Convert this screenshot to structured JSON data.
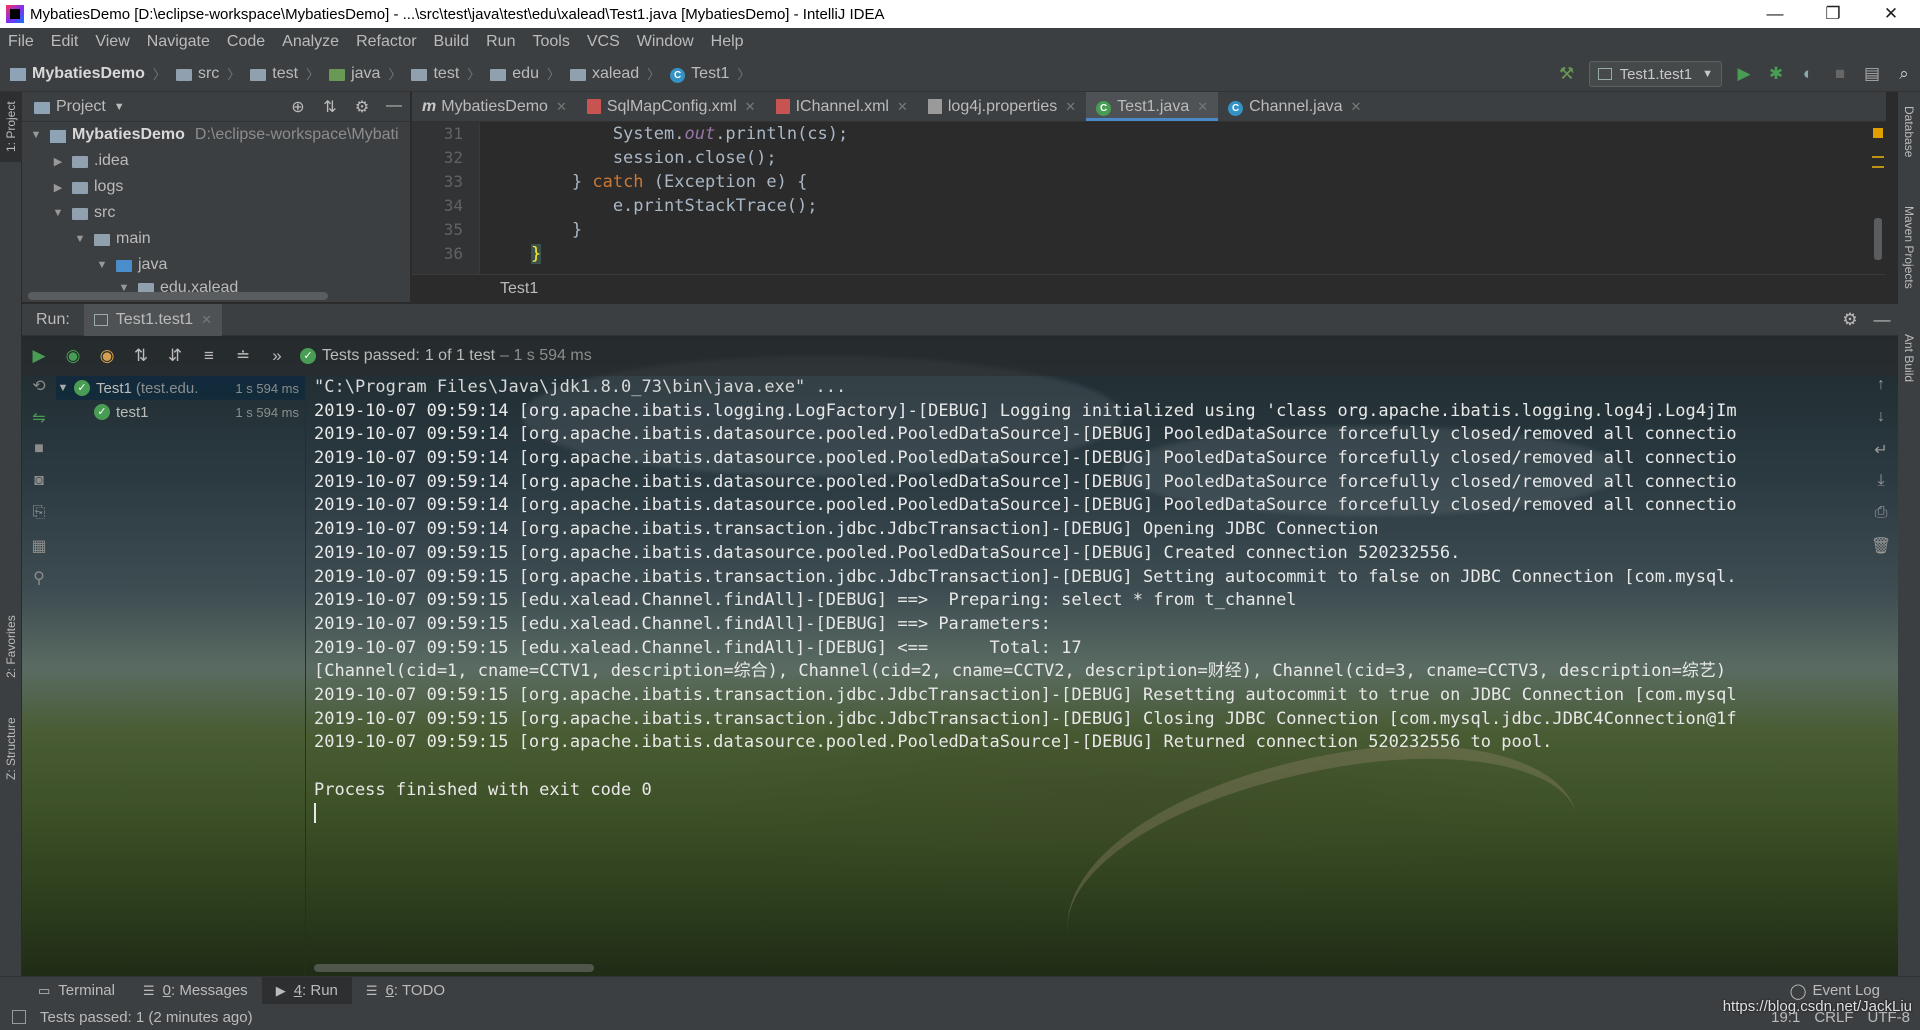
{
  "window": {
    "title": "MybatiesDemo [D:\\eclipse-workspace\\MybatiesDemo] - ...\\src\\test\\java\\test\\edu\\xalead\\Test1.java [MybatiesDemo] - IntelliJ IDEA",
    "minimize": "—",
    "restore": "❐",
    "close": "✕"
  },
  "menu": [
    "File",
    "Edit",
    "View",
    "Navigate",
    "Code",
    "Analyze",
    "Refactor",
    "Build",
    "Run",
    "Tools",
    "VCS",
    "Window",
    "Help"
  ],
  "breadcrumb": [
    "MybatiesDemo",
    "src",
    "test",
    "java",
    "test",
    "edu",
    "xalead",
    "Test1"
  ],
  "toolbar": {
    "run_config": "Test1.test1"
  },
  "project_panel": {
    "title": "Project",
    "root_name": "MybatiesDemo",
    "root_path": "D:\\eclipse-workspace\\Mybati",
    "tree": [
      ".idea",
      "logs",
      "src",
      "main",
      "java",
      "edu.xalead"
    ]
  },
  "editor_tabs": [
    "MybatiesDemo",
    "SqlMapConfig.xml",
    "IChannel.xml",
    "log4j.properties",
    "Test1.java",
    "Channel.java"
  ],
  "editor": {
    "line_numbers": [
      "31",
      "32",
      "33",
      "34",
      "35",
      "36"
    ],
    "lines": {
      "l31_a": "            System.",
      "l31_b": "out",
      "l31_c": ".println(cs);",
      "l32": "            session.close();",
      "l33_a": "        } ",
      "l33_b": "catch",
      "l33_c": " (Exception e) {",
      "l34": "            e.printStackTrace();",
      "l35": "        }",
      "l36_a": "    ",
      "l36_b": "}"
    },
    "crumb": "Test1"
  },
  "run": {
    "label": "Run:",
    "tab": "Test1.test1",
    "status_main": "Tests passed:",
    "status_count": "1 of 1 test",
    "status_time": "– 1 s 594 ms",
    "tree": [
      {
        "name": "Test1",
        "sub": "(test.edu.",
        "time": "1 s 594 ms"
      },
      {
        "name": "test1",
        "time": "1 s 594 ms"
      }
    ],
    "console": [
      "\"C:\\Program Files\\Java\\jdk1.8.0_73\\bin\\java.exe\" ...",
      "2019-10-07 09:59:14 [org.apache.ibatis.logging.LogFactory]-[DEBUG] Logging initialized using 'class org.apache.ibatis.logging.log4j.Log4jIm",
      "2019-10-07 09:59:14 [org.apache.ibatis.datasource.pooled.PooledDataSource]-[DEBUG] PooledDataSource forcefully closed/removed all connectio",
      "2019-10-07 09:59:14 [org.apache.ibatis.datasource.pooled.PooledDataSource]-[DEBUG] PooledDataSource forcefully closed/removed all connectio",
      "2019-10-07 09:59:14 [org.apache.ibatis.datasource.pooled.PooledDataSource]-[DEBUG] PooledDataSource forcefully closed/removed all connectio",
      "2019-10-07 09:59:14 [org.apache.ibatis.datasource.pooled.PooledDataSource]-[DEBUG] PooledDataSource forcefully closed/removed all connectio",
      "2019-10-07 09:59:14 [org.apache.ibatis.transaction.jdbc.JdbcTransaction]-[DEBUG] Opening JDBC Connection",
      "2019-10-07 09:59:15 [org.apache.ibatis.datasource.pooled.PooledDataSource]-[DEBUG] Created connection 520232556.",
      "2019-10-07 09:59:15 [org.apache.ibatis.transaction.jdbc.JdbcTransaction]-[DEBUG] Setting autocommit to false on JDBC Connection [com.mysql.",
      "2019-10-07 09:59:15 [edu.xalead.Channel.findAll]-[DEBUG] ==>  Preparing: select * from t_channel",
      "2019-10-07 09:59:15 [edu.xalead.Channel.findAll]-[DEBUG] ==> Parameters: ",
      "2019-10-07 09:59:15 [edu.xalead.Channel.findAll]-[DEBUG] <==      Total: 17",
      "[Channel(cid=1, cname=CCTV1, description=综合), Channel(cid=2, cname=CCTV2, description=财经), Channel(cid=3, cname=CCTV3, description=综艺)",
      "2019-10-07 09:59:15 [org.apache.ibatis.transaction.jdbc.JdbcTransaction]-[DEBUG] Resetting autocommit to true on JDBC Connection [com.mysql",
      "2019-10-07 09:59:15 [org.apache.ibatis.transaction.jdbc.JdbcTransaction]-[DEBUG] Closing JDBC Connection [com.mysql.jdbc.JDBC4Connection@1f",
      "2019-10-07 09:59:15 [org.apache.ibatis.datasource.pooled.PooledDataSource]-[DEBUG] Returned connection 520232556 to pool.",
      "",
      "Process finished with exit code 0"
    ]
  },
  "side_tabs": {
    "left": [
      "1: Project",
      "2: Favorites",
      "Z: Structure"
    ],
    "right": [
      "Database",
      "Maven Projects",
      "Ant Build"
    ]
  },
  "bottom_tabs": [
    {
      "key": "",
      "label": "Terminal"
    },
    {
      "key": "0",
      "label": ": Messages"
    },
    {
      "key": "4",
      "label": ": Run"
    },
    {
      "key": "6",
      "label": ": TODO"
    }
  ],
  "event_log": "Event Log",
  "status": {
    "message": "Tests passed: 1 (2 minutes ago)",
    "position": "19:1",
    "line_sep": "CRLF",
    "encoding": "UTF-8"
  },
  "watermark": "https://blog.csdn.net/JackLiu"
}
